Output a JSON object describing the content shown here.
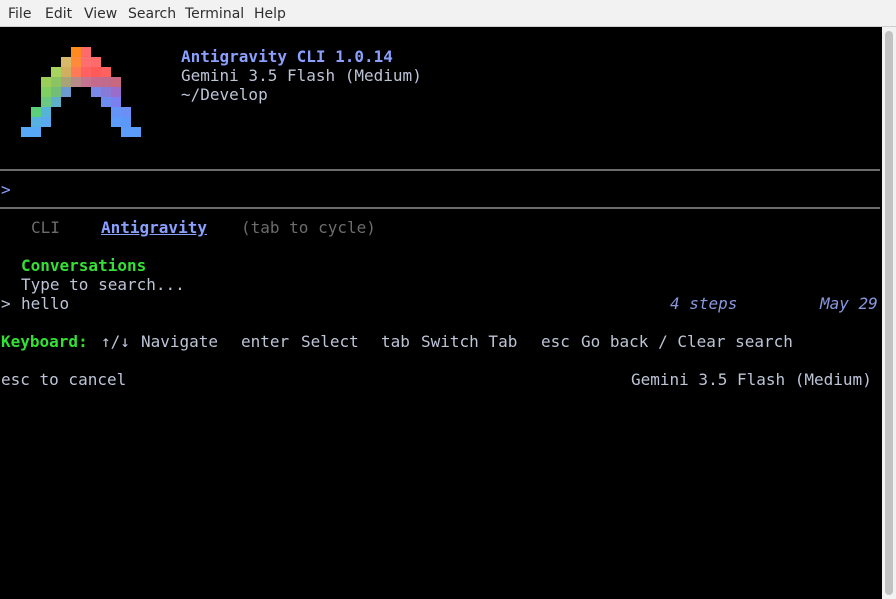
{
  "menu": [
    "File",
    "Edit",
    "View",
    "Search",
    "Terminal",
    "Help"
  ],
  "header": {
    "app_title": "Antigravity CLI 1.0.14",
    "model": "Gemini 3.5 Flash (Medium)",
    "cwd": "~/Develop"
  },
  "prompt_symbol": ">",
  "tabs": {
    "cli": "CLI",
    "antigravity": "Antigravity",
    "hint": "(tab to cycle)"
  },
  "conversations": {
    "heading": "Conversations",
    "search_placeholder": "Type to search...",
    "items": [
      {
        "pointer": ">",
        "title": "hello",
        "steps": "4 steps",
        "date": "May 29"
      }
    ]
  },
  "keyboard": {
    "label": "Keyboard:",
    "shortcuts": [
      {
        "key": "↑/↓",
        "action": "Navigate"
      },
      {
        "key": "enter",
        "action": "Select"
      },
      {
        "key": "tab",
        "action": "Switch Tab"
      },
      {
        "key": "esc",
        "action": "Go back / Clear search"
      }
    ]
  },
  "footer": {
    "cancel_hint": "esc to cancel",
    "model": "Gemini 3.5 Flash (Medium)"
  },
  "colors": {
    "accent_blue": "#8aa0ff",
    "green": "#33e033",
    "dim": "#6c6c6c",
    "text": "#bcc4d6",
    "italic_blue": "#8898e0"
  }
}
